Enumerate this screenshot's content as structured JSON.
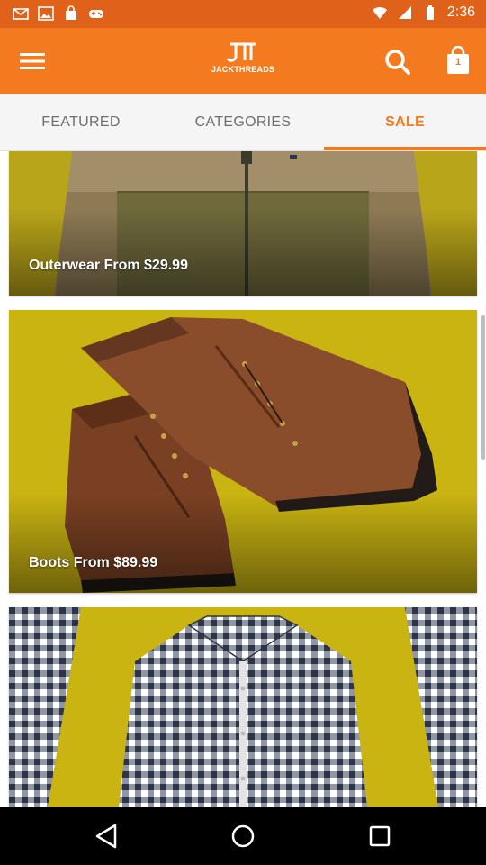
{
  "status_bar": {
    "time": "2:36",
    "icons": [
      "mail-icon",
      "photo-icon",
      "bag-icon",
      "gamepad-icon",
      "wifi-icon",
      "signal-icon",
      "battery-icon"
    ]
  },
  "app_bar": {
    "logo_text": "JACKTHREADS",
    "cart_count": "1",
    "icons": [
      "menu-icon",
      "search-icon",
      "shopping-bag-icon"
    ]
  },
  "tabs": [
    {
      "label": "FEATURED",
      "active": false
    },
    {
      "label": "CATEGORIES",
      "active": false
    },
    {
      "label": "SALE",
      "active": true
    }
  ],
  "feed": {
    "cards": [
      {
        "label": "Outerwear From $29.99",
        "image": "jacket"
      },
      {
        "label": "Boots From $89.99",
        "image": "boots"
      },
      {
        "label": "",
        "image": "gingham-shirt"
      }
    ]
  },
  "nav_bar": {
    "icons": [
      "back-icon",
      "home-icon",
      "recents-icon"
    ]
  },
  "colors": {
    "accent": "#f47a20",
    "status_bar": "#e0621a",
    "card_background": "#c8b314"
  }
}
